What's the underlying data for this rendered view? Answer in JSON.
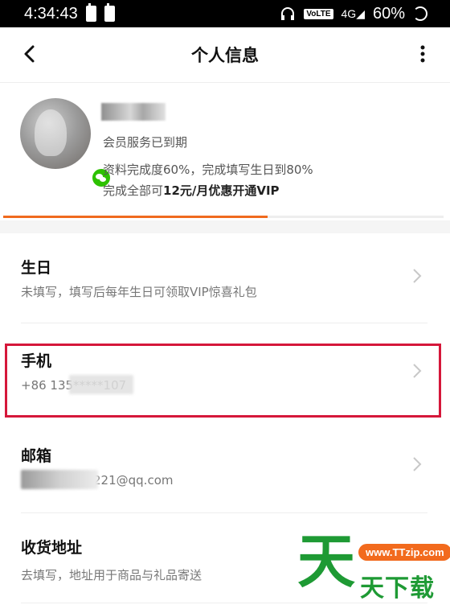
{
  "status_bar": {
    "time": "4:34:43",
    "network_badge": "VoLTE",
    "signal_label": "4G",
    "battery": "60%",
    "icons": [
      "battery-icon",
      "sim-icon",
      "headphones-icon",
      "signal-icon",
      "loading-ring-icon"
    ]
  },
  "header": {
    "title": "个人信息",
    "back_icon": "chevron-left-icon",
    "menu_icon": "more-vertical-icon"
  },
  "profile": {
    "membership_status": "会员服务已到期",
    "completion_text": "资料完成度60%，完成填写生日到80%",
    "promo_prefix": "完成全部可",
    "promo_highlight": "12元/月优惠开通VIP",
    "completion_fraction": 0.6,
    "accent_color": "#f06a1e"
  },
  "rows": [
    {
      "id": "birthday",
      "title": "生日",
      "subtitle": "未填写，填写后每年生日可领取VIP惊喜礼包"
    },
    {
      "id": "phone",
      "title": "手机",
      "subtitle": "+86 135*****107"
    },
    {
      "id": "email",
      "title": "邮箱",
      "subtitle": "221@qq.com"
    },
    {
      "id": "address",
      "title": "收货地址",
      "subtitle": "去填写，地址用于商品与礼品寄送"
    }
  ],
  "highlight_color": "#d5173a",
  "watermark": {
    "big_char": "天",
    "url": "www.TTzip.com",
    "text": "天下载"
  }
}
